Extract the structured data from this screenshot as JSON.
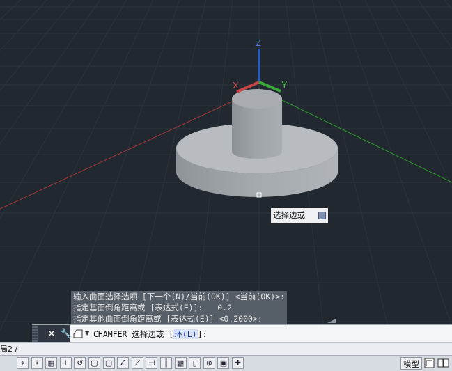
{
  "viewport": {
    "axis_labels": {
      "x": "X",
      "y": "Y",
      "z": "Z"
    },
    "colors": {
      "background": "#212830",
      "grid": "#2d343d",
      "axis_red": "#b33a3a",
      "axis_green": "#2e9a2e",
      "axis_blue": "#3a6fc8",
      "solid": "#b9bdc1"
    }
  },
  "tooltip": {
    "label": "选择边或",
    "dropdown_icon": "dropdown-arrow-icon"
  },
  "command_history": [
    "输入曲面选择选项 [下一个(N)/当前(OK)] <当前(OK)>:",
    "指定基面倒角距离或 [表达式(E)]:   0.2",
    "指定其他曲面倒角距离或 [表达式(E)] <0.2000>:"
  ],
  "command_line": {
    "prefix": "CHAMFER 选择边或 [",
    "option_label": "环(",
    "option_key": "L",
    "option_close": ")",
    "suffix": "]:",
    "close_icon": "close-icon",
    "customize_icon": "wrench-icon"
  },
  "layout_tab": {
    "label": "局2 /"
  },
  "status_bar": {
    "model_label": "模型",
    "icons": [
      "coordinate-icon",
      "infer-icon",
      "grid-icon",
      "snap-icon",
      "dynucs-icon",
      "osnap-icon",
      "osnap3d-icon",
      "polar-icon",
      "otrack-icon",
      "dynamic-input-icon",
      "lineweight-icon",
      "transparency-icon",
      "selection-cycling-icon",
      "annotation-icon",
      "workspace-icon",
      "plus-icon"
    ],
    "right_icons": [
      "paper-space-icon",
      "layout-icon"
    ]
  }
}
